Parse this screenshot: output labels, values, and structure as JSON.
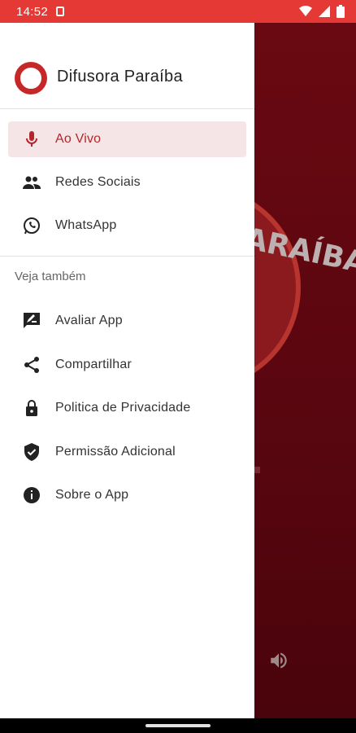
{
  "status_bar": {
    "time": "14:52"
  },
  "drawer": {
    "title": "Difusora Paraíba",
    "main_items": [
      {
        "label": "Ao Vivo",
        "icon": "microphone-icon",
        "active": true
      },
      {
        "label": "Redes Sociais",
        "icon": "people-icon",
        "active": false
      },
      {
        "label": "WhatsApp",
        "icon": "whatsapp-icon",
        "active": false
      }
    ],
    "section_title": "Veja também",
    "more_items": [
      {
        "label": "Avaliar App",
        "icon": "rate-review-icon"
      },
      {
        "label": "Compartilhar",
        "icon": "share-icon"
      },
      {
        "label": "Politica de Privacidade",
        "icon": "lock-icon"
      },
      {
        "label": "Permissão Adicional",
        "icon": "shield-check-icon"
      },
      {
        "label": "Sobre o App",
        "icon": "info-icon"
      }
    ]
  },
  "background": {
    "logo_text": "ARAÍBA"
  },
  "colors": {
    "status_bar": "#e53935",
    "accent": "#b3262e",
    "active_bg": "#f6e5e6",
    "background_app": "#5b0610"
  }
}
